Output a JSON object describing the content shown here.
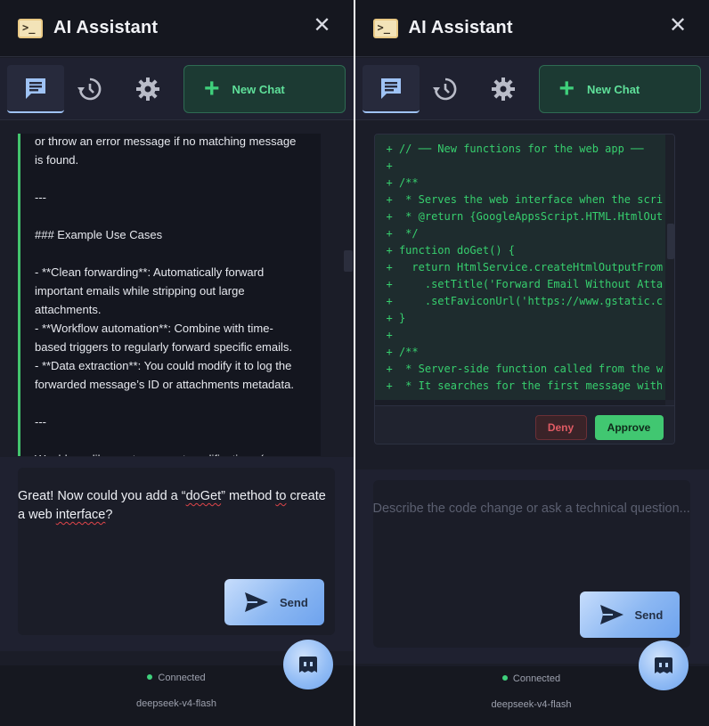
{
  "colors": {
    "panel_bg": "#1b1d28",
    "accent_green": "#3fd07c",
    "accent_blue": "#8bb7f2",
    "deny_red": "#e05b64"
  },
  "left": {
    "header": {
      "title": "AI Assistant",
      "close_icon": "close-icon"
    },
    "tabs": [
      {
        "name": "chat",
        "icon": "chat-icon",
        "active": true
      },
      {
        "name": "history",
        "icon": "history-icon",
        "active": false
      },
      {
        "name": "settings",
        "icon": "gear-icon",
        "active": false
      }
    ],
    "new_chat_label": "New Chat",
    "conversation_text": "or throw an error message if no matching message\nis found.\n\n---\n\n### Example Use Cases\n\n- **Clean forwarding**: Automatically forward\nimportant emails while stripping out large\nattachments.\n- **Workflow automation**: Combine with time-\nbased triggers to regularly forward specific emails.\n- **Data extraction**: You could modify it to log the\nforwarded message’s ID or attachments metadata.\n\n---\n\nWould you like me to suggest modifications (e.g.,",
    "input": {
      "p1": "Great! Now could you add a “",
      "w1": "doGet",
      "p2": "” method ",
      "w2": "to",
      "p3": " create a web ",
      "w3": "interface",
      "p4": "?"
    },
    "send_label": "Send",
    "status": "Connected",
    "model": "deepseek-v4-flash"
  },
  "right": {
    "header": {
      "title": "AI Assistant"
    },
    "new_chat_label": "New Chat",
    "code_lines": [
      "+ // ── New functions for the web app ──",
      "+",
      "+ /**",
      "+  * Serves the web interface when the scri",
      "+  * @return {GoogleAppsScript.HTML.HtmlOut",
      "+  */",
      "+ function doGet() {",
      "+   return HtmlService.createHtmlOutputFrom",
      "+     .setTitle('Forward Email Without Atta",
      "+     .setFaviconUrl('https://www.gstatic.c",
      "+ }",
      "+",
      "+ /**",
      "+  * Server-side function called from the w",
      "+  * It searches for the first message with"
    ],
    "deny_label": "Deny",
    "approve_label": "Approve",
    "placeholder": "Describe the code change or ask a technical question...",
    "send_label": "Send",
    "status": "Connected",
    "model": "deepseek-v4-flash"
  }
}
